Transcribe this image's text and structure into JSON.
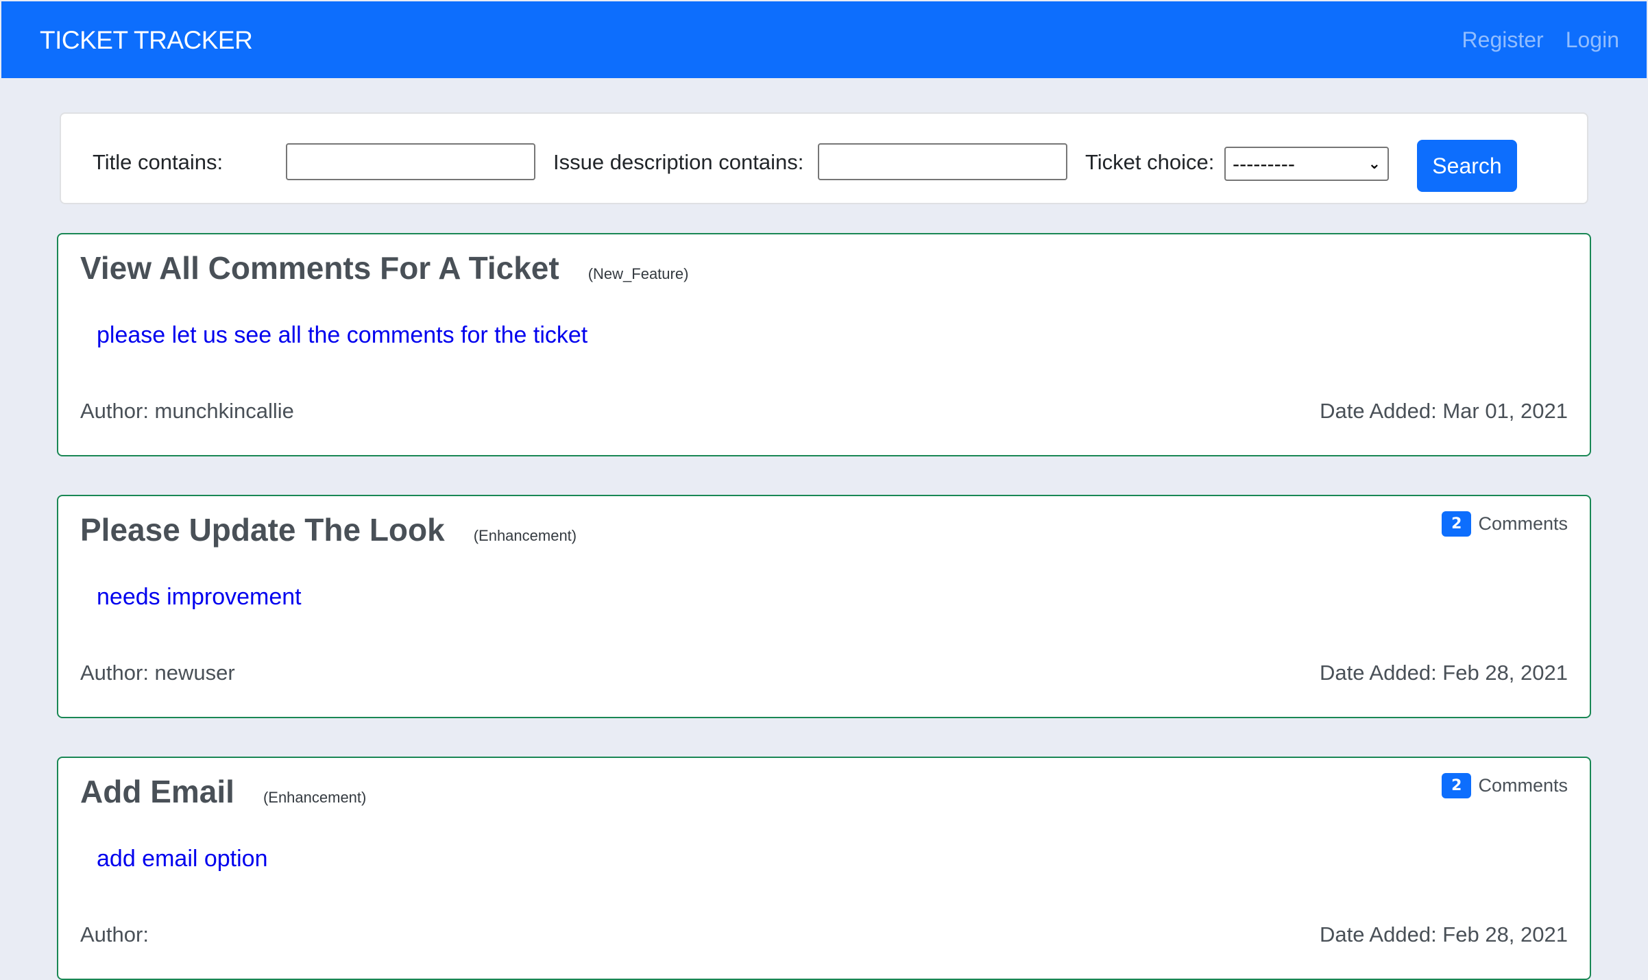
{
  "navbar": {
    "brand": "TICKET TRACKER",
    "links": [
      "Register",
      "Login"
    ],
    "color": "#0d6efd"
  },
  "filters": {
    "title_label": "Title contains:",
    "title_value": "",
    "issue_label": "Issue description contains:",
    "issue_value": "",
    "ticket_label": "Ticket choice:",
    "ticket_selected": "---------",
    "search_label": "Search"
  },
  "tickets": [
    {
      "title": "View All Comments For A Ticket",
      "type": "(New_Feature)",
      "description": "please let us see all the comments for the ticket",
      "author": "Author: munchkincallie",
      "date": "Date Added: Mar 01, 2021"
    },
    {
      "title": "Please Update The Look",
      "type": "(Enhancement)",
      "description": "needs improvement",
      "author": "Author: newuser",
      "date": "Date Added: Feb 28, 2021",
      "comment_count": "2",
      "comments_label": "Comments"
    },
    {
      "title": "Add Email",
      "type": "(Enhancement)",
      "description": "add email option",
      "author": "Author:",
      "date": "Date Added: Feb 28, 2021",
      "comment_count": "2",
      "comments_label": "Comments"
    }
  ]
}
